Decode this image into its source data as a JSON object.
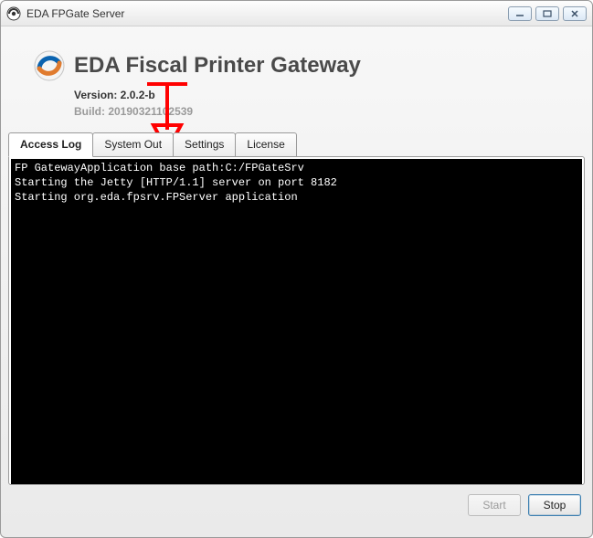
{
  "window": {
    "title": "EDA FPGate Server",
    "controls": {
      "min": "‒",
      "max": "▢",
      "close": "✕"
    }
  },
  "header": {
    "brand_title": "EDA Fiscal Printer Gateway",
    "version_label": "Version: 2.0.2-b",
    "build_label": "Build: 20190321102539"
  },
  "tabs": [
    {
      "label": "Access Log",
      "active": true
    },
    {
      "label": "System Out",
      "active": false
    },
    {
      "label": "Settings",
      "active": false
    },
    {
      "label": "License",
      "active": false
    }
  ],
  "console": {
    "lines": [
      "FP GatewayApplication base path:C:/FPGateSrv",
      "Starting the Jetty [HTTP/1.1] server on port 8182",
      "Starting org.eda.fpsrv.FPServer application"
    ]
  },
  "footer": {
    "start_label": "Start",
    "stop_label": "Stop",
    "start_enabled": false,
    "stop_enabled": true
  },
  "annotation": {
    "arrow_color": "#ff0000",
    "arrow_target_tab": "Settings"
  }
}
